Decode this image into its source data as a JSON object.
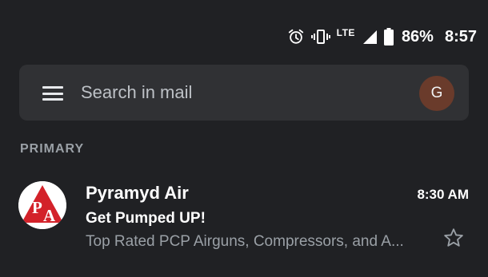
{
  "status_bar": {
    "network": "LTE",
    "battery": "86%",
    "time": "8:57"
  },
  "search": {
    "placeholder": "Search in mail",
    "account_initial": "G"
  },
  "section": {
    "label": "PRIMARY"
  },
  "emails": [
    {
      "sender": "Pyramyd Air",
      "time": "8:30 AM",
      "subject": "Get Pumped UP!",
      "preview": "Top Rated PCP Airguns, Compressors, and A...",
      "logo_text": "PA",
      "starred": false
    }
  ],
  "colors": {
    "background": "#202124",
    "search_bar": "#303134",
    "avatar": "#6a3b2b",
    "logo_red": "#d3222a"
  }
}
